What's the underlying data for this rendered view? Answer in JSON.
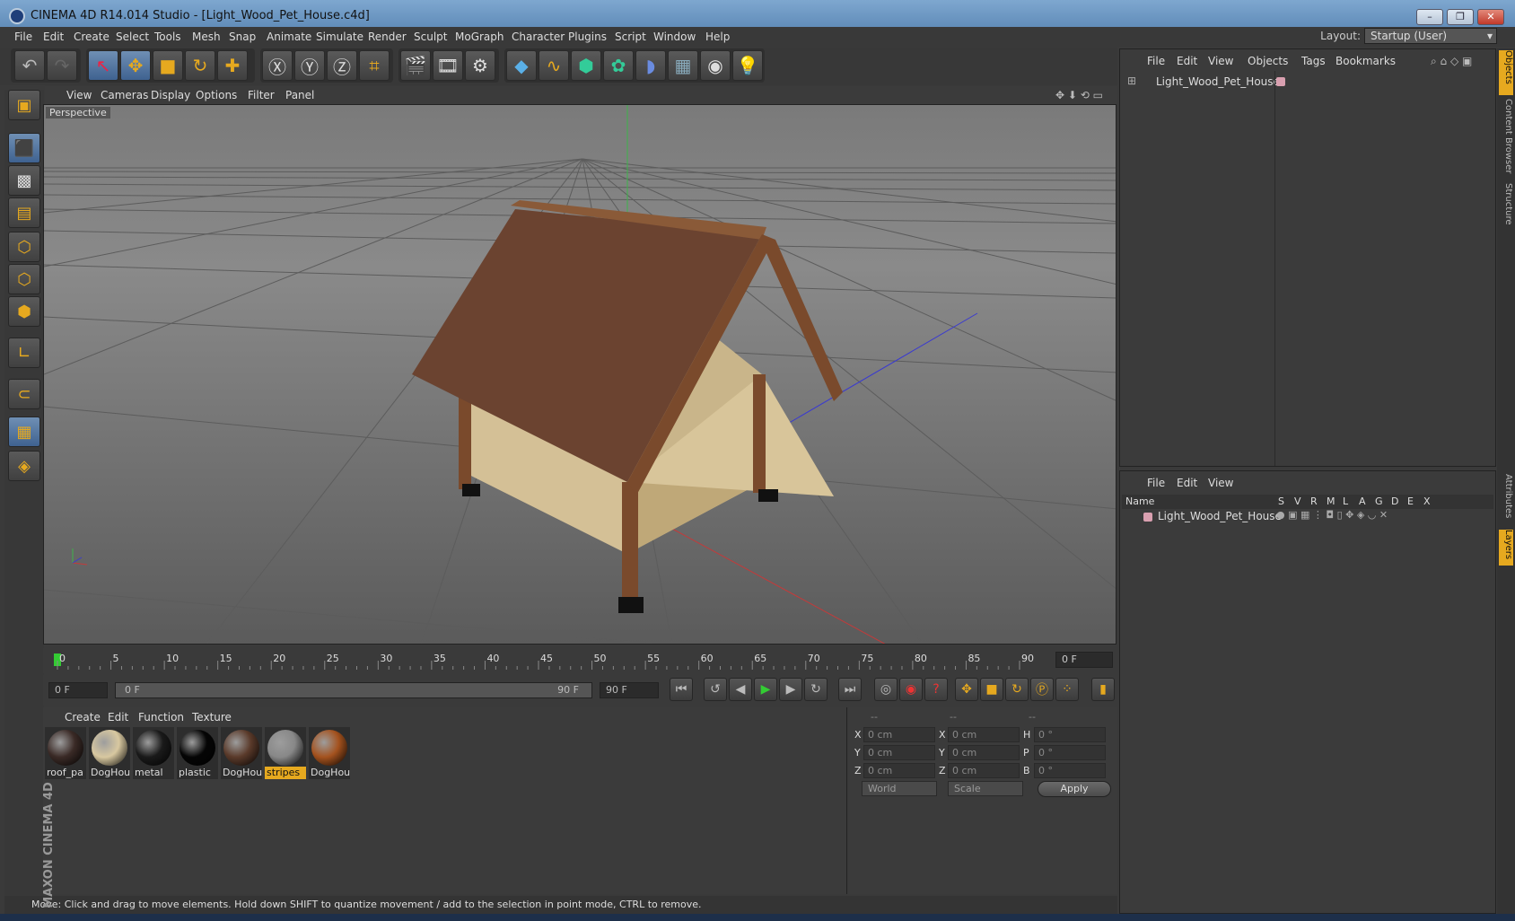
{
  "window": {
    "title": "CINEMA 4D R14.014 Studio - [Light_Wood_Pet_House.c4d]",
    "buttons": [
      "–",
      "❐",
      "✕"
    ]
  },
  "menubar": {
    "items": [
      "File",
      "Edit",
      "Create",
      "Select",
      "Tools",
      "Mesh",
      "Snap",
      "Animate",
      "Simulate",
      "Render",
      "Sculpt",
      "MoGraph",
      "Character",
      "Plugins",
      "Script",
      "Window",
      "Help"
    ],
    "layout_label": "Layout:",
    "layout_value": "Startup (User)"
  },
  "viewport": {
    "menu": [
      "View",
      "Cameras",
      "Display",
      "Options",
      "Filter",
      "Panel"
    ],
    "label": "Perspective"
  },
  "timeline": {
    "ticks": [
      "0",
      "5",
      "10",
      "15",
      "20",
      "25",
      "30",
      "35",
      "40",
      "45",
      "50",
      "55",
      "60",
      "65",
      "70",
      "75",
      "80",
      "85",
      "90"
    ],
    "current_frame": "0 F"
  },
  "transport": {
    "start_field": "0 F",
    "range_start": "0 F",
    "range_end": "90 F",
    "end_field": "90 F"
  },
  "material_manager": {
    "menu": [
      "Create",
      "Edit",
      "Function",
      "Texture"
    ],
    "materials": [
      {
        "label": "roof_pa",
        "color": "#3a2a26"
      },
      {
        "label": "DogHou",
        "color": "#d8c8a0"
      },
      {
        "label": "metal",
        "color": "#1a1a1a"
      },
      {
        "label": "plastic",
        "color": "#050505"
      },
      {
        "label": "DogHou",
        "color": "#5a3a2a"
      },
      {
        "label": "stripes",
        "color": "#888888"
      },
      {
        "label": "DogHou",
        "color": "#a4521e"
      }
    ],
    "selected": "stripes"
  },
  "coordinates": {
    "headers": [
      "--",
      "--",
      "--"
    ],
    "rows": [
      {
        "a": "X",
        "av": "0 cm",
        "b": "X",
        "bv": "0 cm",
        "c": "H",
        "cv": "0 °"
      },
      {
        "a": "Y",
        "av": "0 cm",
        "b": "Y",
        "bv": "0 cm",
        "c": "P",
        "cv": "0 °"
      },
      {
        "a": "Z",
        "av": "0 cm",
        "b": "Z",
        "bv": "0 cm",
        "c": "B",
        "cv": "0 °"
      }
    ],
    "world": "World",
    "scale": "Scale",
    "apply": "Apply"
  },
  "status": "Move: Click and drag to move elements. Hold down SHIFT to quantize movement / add to the selection in point mode, CTRL to remove.",
  "object_manager": {
    "menu": [
      "File",
      "Edit",
      "View",
      "Objects",
      "Tags",
      "Bookmarks"
    ],
    "object": "Light_Wood_Pet_House"
  },
  "layer_manager": {
    "menu": [
      "File",
      "Edit",
      "View"
    ],
    "columns": [
      "Name",
      "S",
      "V",
      "R",
      "M",
      "L",
      "A",
      "G",
      "D",
      "E",
      "X"
    ],
    "layer": "Light_Wood_Pet_House"
  },
  "side_tabs": [
    "Objects",
    "Content Browser",
    "Structure",
    "Attributes",
    "Layers"
  ],
  "brand": "MAXON CINEMA 4D"
}
